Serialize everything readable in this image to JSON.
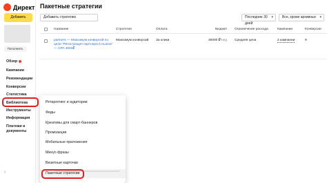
{
  "app": {
    "logo_text": "Директ",
    "add_button": "Добавить",
    "account_button": "Пополнить"
  },
  "sidebar": {
    "items": [
      {
        "label": "Обзор",
        "badge": true
      },
      {
        "label": "Кампании"
      },
      {
        "label": "Рекомендации"
      },
      {
        "label": "Конверсии"
      },
      {
        "label": "Статистика"
      },
      {
        "label": "Библиотека"
      },
      {
        "label": "Инструменты"
      },
      {
        "label": "Информация"
      },
      {
        "label": "Платежи и документы"
      }
    ]
  },
  "page": {
    "title": "Пакетные стратегии",
    "add_strategy_button": "Добавить стратегию",
    "period_filter": "Последние 30 дней",
    "status_filter": "Все, кроме архивных"
  },
  "table": {
    "columns": [
      "Название",
      "Стратегия",
      "Оплата",
      "Бюджет",
      "Ограничение расхода",
      "Кампании",
      "Конверсии"
    ],
    "rows": [
      {
        "name": "partners — Максимум конверсий по цели \"Регистрация партнера в eLama\" — CPA 4002₽",
        "strategy": "Максимум конверсий",
        "payment": "За клики",
        "budget": "30000 ₽",
        "budget_suffix": "/нед",
        "limit": "Средняя цена",
        "campaigns": "2 кампании",
        "conversions": "9"
      }
    ]
  },
  "library_menu": {
    "items": [
      "Ретаргетинг и аудитории",
      "Фиды",
      "Креативы для смарт-баннеров",
      "Промоакции",
      "Мобильные приложения",
      "Минус-фразы",
      "Визитные карточки",
      "Пакетные стратегии"
    ]
  },
  "colors": {
    "brand_yellow": "#ffdb4d",
    "highlight_red": "#e02020",
    "link_blue": "#2770d9",
    "logo_red": "#fc3f1d"
  }
}
